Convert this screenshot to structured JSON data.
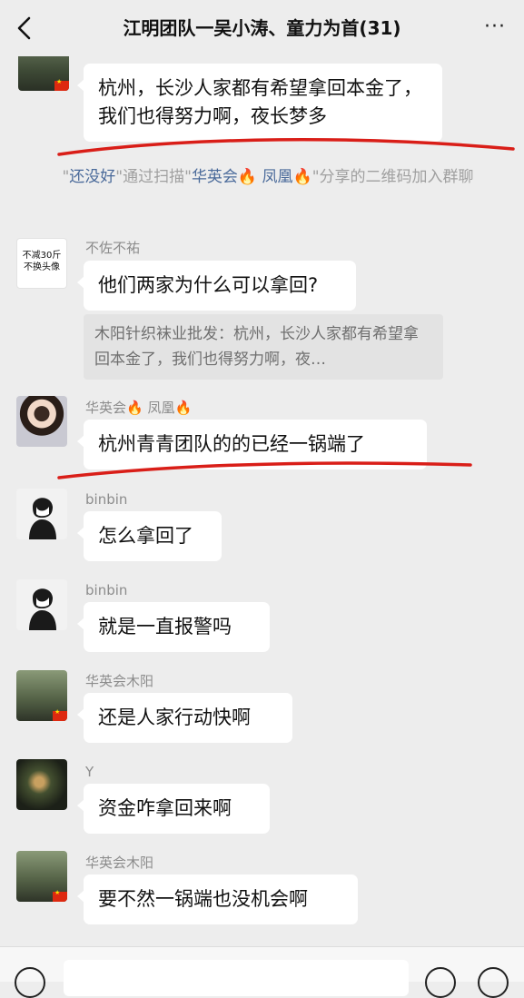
{
  "header": {
    "title": "江明团队一吴小涛、童力为首(31)",
    "more": "···"
  },
  "messages": [
    {
      "text": "杭州，长沙人家都有希望拿回本金了，我们也得努力啊，夜长梦多"
    },
    {
      "sender": "不佐不祐",
      "avatar_text": "不减30斤 不换头像",
      "text": "他们两家为什么可以拿回?",
      "quote": "木阳针织袜业批发：杭州，长沙人家都有希望拿回本金了，我们也得努力啊，夜…"
    },
    {
      "sender": "华英会🔥 凤凰🔥",
      "text": "杭州青青团队的的已经一锅端了"
    },
    {
      "sender": "binbin",
      "text": "怎么拿回了"
    },
    {
      "sender": "binbin",
      "text": "就是一直报警吗"
    },
    {
      "sender": "华英会木阳",
      "text": "还是人家行动快啊"
    },
    {
      "sender": "Y",
      "text": "资金咋拿回来啊"
    },
    {
      "sender": "华英会木阳",
      "text": "要不然一锅端也没机会啊"
    }
  ],
  "system_notice": {
    "quote_open": "\"",
    "inviter": "还没好",
    "mid": "\"通过扫描\"",
    "scanner": "华英会🔥 凤凰🔥",
    "tail": "\"分享的二维码加入群聊"
  },
  "colors": {
    "background": "#ededed",
    "bubble": "#ffffff",
    "highlight_name": "#4a6a9a",
    "red_underline": "#d91e18"
  },
  "icons": [
    "back-icon",
    "more-icon",
    "voice-icon",
    "emoji-icon",
    "plus-icon"
  ]
}
